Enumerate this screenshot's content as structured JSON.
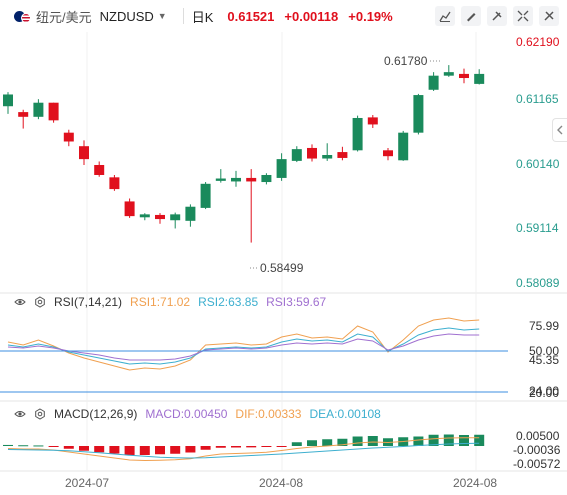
{
  "toolbar": {
    "pair_cn": "纽元/美元",
    "symbol": "NZDUSD",
    "timeframe": "日K",
    "price": "0.61521",
    "change": "+0.00118",
    "change_pct": "+0.19%",
    "icons": [
      "chart-type-icon",
      "draw-icon",
      "indicator-icon",
      "fullscreen-icon",
      "settings-icon"
    ]
  },
  "colors": {
    "up": "#1a8a5c",
    "down": "#e0101d",
    "accent": "#3d8fe0"
  },
  "price_axis": [
    "0.62190",
    "0.61165",
    "0.60140",
    "0.59114",
    "0.58089"
  ],
  "annotations": {
    "high": "0.61780",
    "low": "0.58499"
  },
  "rsi": {
    "title": "RSI(7,14,21)",
    "rsi1": "RSI1:71.02",
    "rsi2": "RSI2:63.85",
    "rsi3": "RSI3:59.67",
    "axis": [
      "75.99",
      "50.00",
      "45.35",
      "24.00",
      "20.00"
    ]
  },
  "macd": {
    "title": "MACD(12,26,9)",
    "macd": "MACD:0.00450",
    "dif": "DIF:0.00333",
    "dea": "DEA:0.00108",
    "axis": [
      "0.00500",
      "-0.00036",
      "-0.00572"
    ]
  },
  "x_axis": [
    "2024-07",
    "2024-08",
    "2024-08"
  ],
  "chart_data": {
    "type": "candlestick",
    "candles": [
      [
        0.6108,
        0.6128,
        0.6132,
        0.6095
      ],
      [
        0.6098,
        0.609,
        0.6102,
        0.607
      ],
      [
        0.609,
        0.6114,
        0.612,
        0.6086
      ],
      [
        0.6114,
        0.6084,
        0.6114,
        0.608
      ],
      [
        0.6063,
        0.6048,
        0.6068,
        0.604
      ],
      [
        0.604,
        0.6018,
        0.605,
        0.6008
      ],
      [
        0.6008,
        0.5991,
        0.6014,
        0.5988
      ],
      [
        0.5987,
        0.5967,
        0.5991,
        0.5964
      ],
      [
        0.5946,
        0.5921,
        0.5951,
        0.5918
      ],
      [
        0.5919,
        0.5924,
        0.5926,
        0.5914
      ],
      [
        0.5923,
        0.5916,
        0.5926,
        0.5908
      ],
      [
        0.5914,
        0.5924,
        0.5927,
        0.59
      ],
      [
        0.5913,
        0.5937,
        0.5941,
        0.5903
      ],
      [
        0.5935,
        0.5976,
        0.5979,
        0.5933
      ],
      [
        0.5981,
        0.5985,
        0.6001,
        0.5978
      ],
      [
        0.598,
        0.5986,
        0.5998,
        0.5971
      ],
      [
        0.5986,
        0.598,
        0.6001,
        0.5876
      ],
      [
        0.5979,
        0.5991,
        0.5994,
        0.5975
      ],
      [
        0.5986,
        0.6018,
        0.6028,
        0.5981
      ],
      [
        0.6015,
        0.6035,
        0.604,
        0.6013
      ],
      [
        0.6037,
        0.6019,
        0.6043,
        0.6014
      ],
      [
        0.6019,
        0.6025,
        0.6045,
        0.6015
      ],
      [
        0.603,
        0.602,
        0.6039,
        0.6016
      ],
      [
        0.6033,
        0.6088,
        0.6092,
        0.6031
      ],
      [
        0.6089,
        0.6077,
        0.6093,
        0.6071
      ],
      [
        0.6033,
        0.6023,
        0.6037,
        0.6016
      ],
      [
        0.6016,
        0.6063,
        0.6066,
        0.6015
      ],
      [
        0.6063,
        0.6127,
        0.6129,
        0.606
      ],
      [
        0.6136,
        0.616,
        0.6166,
        0.6134
      ],
      [
        0.616,
        0.6166,
        0.6178,
        0.6158
      ],
      [
        0.6163,
        0.6156,
        0.6172,
        0.6147
      ],
      [
        0.6146,
        0.6163,
        0.6171,
        0.6145
      ]
    ],
    "rsi1": [
      58,
      55,
      60,
      54,
      47,
      42,
      38,
      34,
      30,
      32,
      31,
      34,
      40,
      55,
      56,
      57,
      55,
      56,
      63,
      66,
      62,
      63,
      61,
      74,
      68,
      48,
      60,
      74,
      80,
      82,
      79,
      80
    ],
    "rsi2": [
      55,
      53,
      56,
      53,
      48,
      45,
      42,
      39,
      36,
      37,
      36,
      38,
      42,
      51,
      52,
      53,
      52,
      53,
      58,
      61,
      59,
      60,
      58,
      66,
      63,
      49,
      56,
      65,
      70,
      72,
      70,
      71
    ],
    "rsi3": [
      53,
      52,
      54,
      52,
      49,
      47,
      45,
      42,
      40,
      40,
      40,
      41,
      44,
      50,
      51,
      52,
      51,
      52,
      55,
      57,
      56,
      57,
      56,
      61,
      59,
      50,
      54,
      60,
      64,
      66,
      65,
      65
    ],
    "macd_hist": [
      0.00042,
      0.0003,
      0.00022,
      -0.0002,
      -0.0011,
      -0.0019,
      -0.0025,
      -0.003,
      -0.0036,
      -0.0036,
      -0.0033,
      -0.0031,
      -0.0026,
      -0.0015,
      -0.0007,
      -0.0006,
      -0.00055,
      -0.0004,
      -0.0001,
      0.0015,
      0.0023,
      0.0027,
      0.0029,
      0.0038,
      0.004,
      0.0031,
      0.0035,
      0.0038,
      0.0045,
      0.0046,
      0.0044,
      0.0045
    ],
    "dif": [
      -0.001,
      -0.0012,
      -0.0012,
      -0.0016,
      -0.0024,
      -0.0032,
      -0.004,
      -0.0048,
      -0.0056,
      -0.0058,
      -0.0057,
      -0.0055,
      -0.0051,
      -0.004,
      -0.0032,
      -0.003,
      -0.0028,
      -0.0025,
      -0.0018,
      -0.001,
      -0.0004,
      0.0,
      0.0005,
      0.0012,
      0.0016,
      0.0014,
      0.0018,
      0.0024,
      0.0029,
      0.0032,
      0.0033,
      0.0033
    ],
    "dea": [
      -0.0014,
      -0.0015,
      -0.0016,
      -0.0017,
      -0.0019,
      -0.0023,
      -0.0027,
      -0.0032,
      -0.0037,
      -0.0041,
      -0.0045,
      -0.0047,
      -0.0048,
      -0.0047,
      -0.0044,
      -0.0041,
      -0.0038,
      -0.0035,
      -0.0032,
      -0.0028,
      -0.0024,
      -0.002,
      -0.0016,
      -0.0012,
      -0.0008,
      -0.0005,
      -0.0002,
      0.0002,
      0.0005,
      0.0008,
      0.001,
      0.0011
    ]
  }
}
